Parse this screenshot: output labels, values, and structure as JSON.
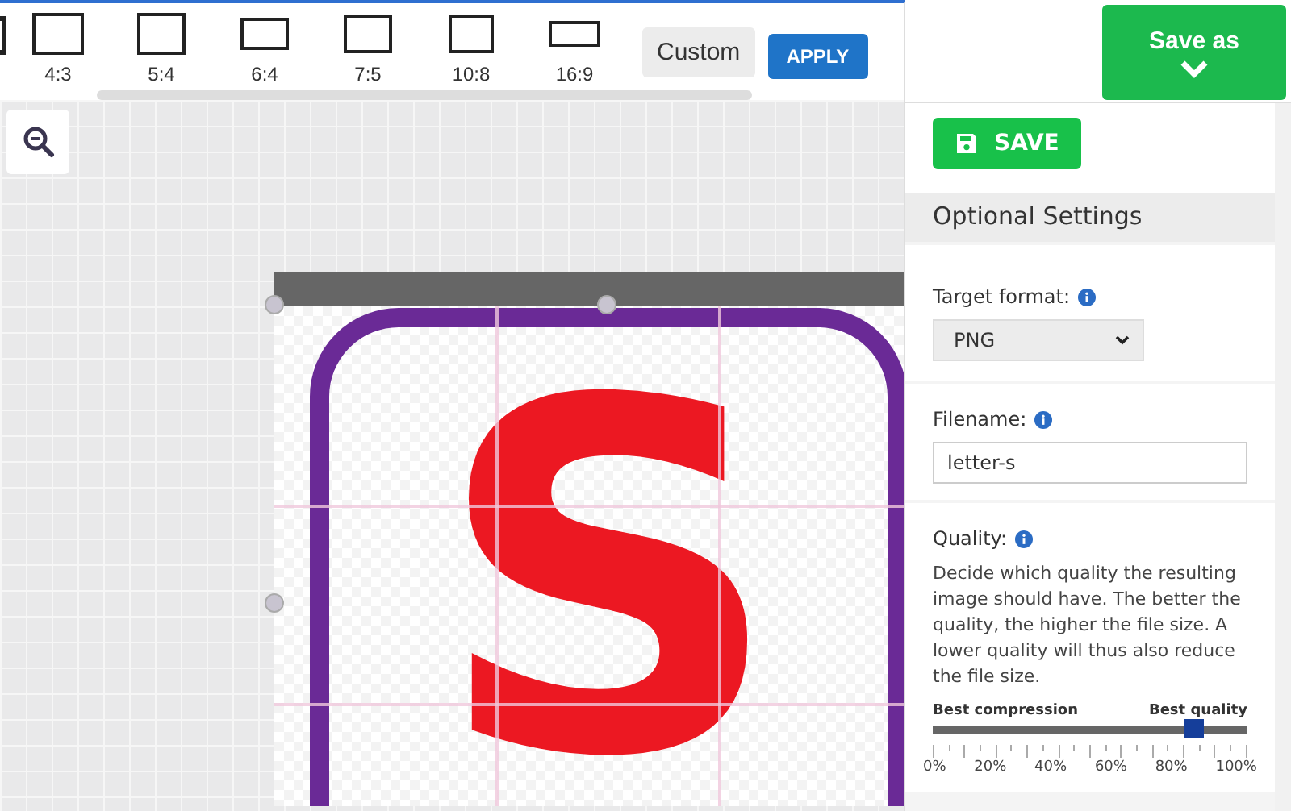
{
  "toolbar": {
    "ratios": [
      {
        "label": "4:3"
      },
      {
        "label": "5:4"
      },
      {
        "label": "6:4"
      },
      {
        "label": "7:5"
      },
      {
        "label": "10:8"
      },
      {
        "label": "16:9"
      }
    ],
    "custom_button": "Custom",
    "apply_button": "APPLY"
  },
  "save_as_button": "Save as",
  "canvas": {
    "image_letter": "S"
  },
  "panel": {
    "save_button": "SAVE",
    "header": "Optional Settings",
    "target_format": {
      "label": "Target format:",
      "value": "PNG"
    },
    "filename": {
      "label": "Filename:",
      "value": "letter-s"
    },
    "quality": {
      "label": "Quality:",
      "description": "Decide which quality the resulting image should have. The better the quality, the higher the file size. A lower quality will thus also reduce the file size.",
      "min_label": "Best compression",
      "max_label": "Best quality",
      "level": 0.83,
      "ticks": [
        "0%",
        "20%",
        "40%",
        "60%",
        "80%",
        "100%"
      ]
    }
  }
}
